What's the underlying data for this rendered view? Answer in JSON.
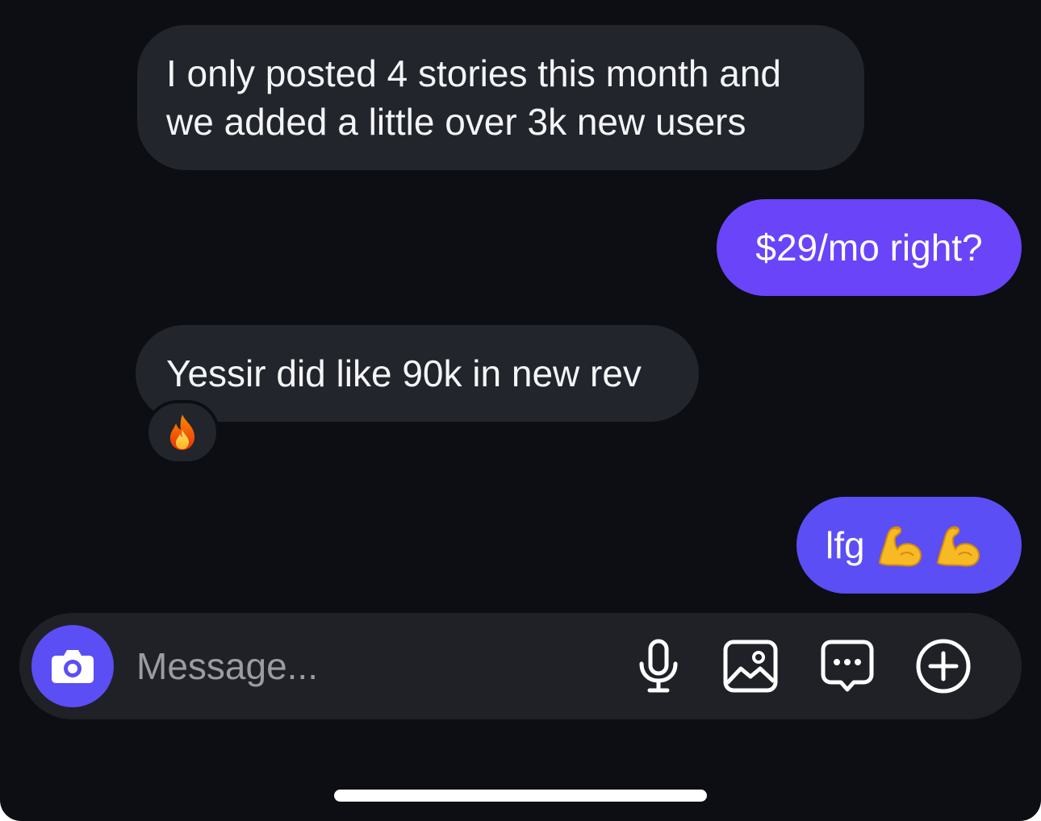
{
  "conversation": {
    "messages": [
      {
        "direction": "incoming",
        "lines": [
          "I only posted 4 stories this month and",
          "we added a little over 3k new users"
        ]
      },
      {
        "direction": "outgoing",
        "text": "$29/mo right?"
      },
      {
        "direction": "incoming",
        "text": "Yessir did like 90k in new rev",
        "reaction": "fire-emoji"
      },
      {
        "direction": "outgoing",
        "text": "lfg",
        "emojis": [
          "flexed-biceps-emoji",
          "flexed-biceps-emoji"
        ]
      }
    ]
  },
  "composer": {
    "placeholder": "Message...",
    "value": "",
    "icons": [
      "camera-icon",
      "microphone-icon",
      "gallery-icon",
      "chat-bubble-icon",
      "plus-circle-icon"
    ]
  },
  "colors": {
    "background": "#0c0e13",
    "incoming_bubble": "#22252b",
    "outgoing_bubble_1": "#6a44f8",
    "outgoing_bubble_2": "#5b4ef4",
    "composer": "#1f2126",
    "camera_button": "#5b4ef4",
    "placeholder": "#9a9ca3"
  }
}
